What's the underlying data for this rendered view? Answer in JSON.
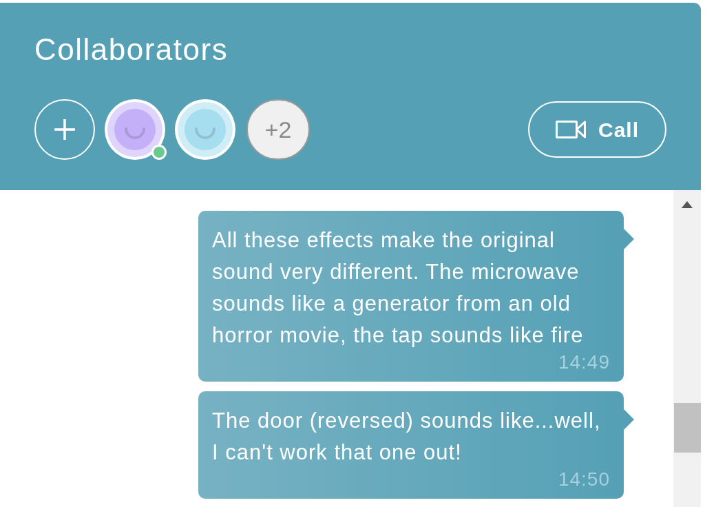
{
  "header": {
    "title": "Collaborators",
    "collaborators": [
      {
        "kind": "avatar",
        "color": "#c4b0f8",
        "online": true
      },
      {
        "kind": "avatar",
        "color": "#a6def0",
        "online": false
      },
      {
        "kind": "more",
        "label": "+2"
      }
    ],
    "call_button": {
      "label": "Call"
    }
  },
  "messages": [
    {
      "text": "All these effects make the original sound very different. The microwave sounds like a generator from an old horror movie, the tap sounds like fire",
      "time": "14:49"
    },
    {
      "text": "The door (reversed) sounds like...well, I can't work that one out!",
      "time": "14:50"
    }
  ]
}
